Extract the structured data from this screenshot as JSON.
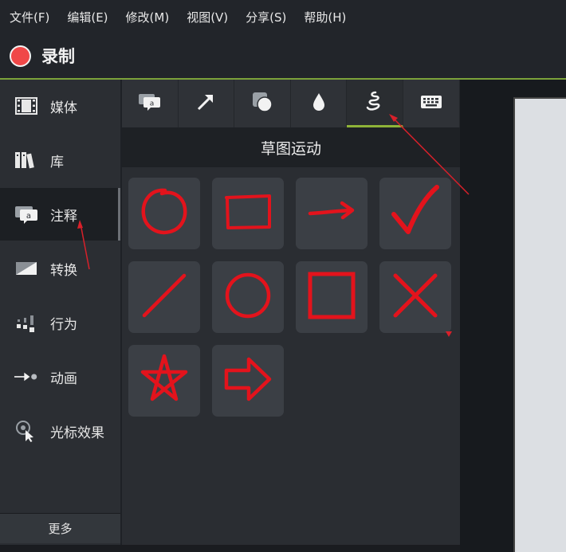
{
  "menubar": {
    "items": [
      {
        "label": "文件(F)"
      },
      {
        "label": "编辑(E)"
      },
      {
        "label": "修改(M)"
      },
      {
        "label": "视图(V)"
      },
      {
        "label": "分享(S)"
      },
      {
        "label": "帮助(H)"
      }
    ]
  },
  "recordbar": {
    "label": "录制",
    "dot_color": "#f04848"
  },
  "sidebar": {
    "items": [
      {
        "label": "媒体",
        "icon": "film-strip-icon"
      },
      {
        "label": "库",
        "icon": "books-icon"
      },
      {
        "label": "注释",
        "icon": "annotation-callout-icon",
        "active": true
      },
      {
        "label": "转换",
        "icon": "transition-icon"
      },
      {
        "label": "行为",
        "icon": "behavior-icon"
      },
      {
        "label": "动画",
        "icon": "animation-icon"
      },
      {
        "label": "光标效果",
        "icon": "cursor-effect-icon"
      }
    ],
    "more_label": "更多"
  },
  "panel": {
    "tabs": [
      {
        "icon": "callout-icon"
      },
      {
        "icon": "arrow-icon"
      },
      {
        "icon": "shapes-icon"
      },
      {
        "icon": "blur-drop-icon"
      },
      {
        "icon": "sketch-motion-icon",
        "active": true
      },
      {
        "icon": "keyboard-icon"
      }
    ],
    "title": "草图运动",
    "tiles": [
      {
        "icon": "sketch-circle-icon"
      },
      {
        "icon": "sketch-rectangle-icon"
      },
      {
        "icon": "sketch-arrow-icon"
      },
      {
        "icon": "sketch-checkmark-icon"
      },
      {
        "icon": "sketch-line-icon"
      },
      {
        "icon": "sketch-ellipse-icon"
      },
      {
        "icon": "sketch-square-icon"
      },
      {
        "icon": "sketch-x-icon"
      },
      {
        "icon": "sketch-star-icon"
      },
      {
        "icon": "sketch-block-arrow-icon"
      }
    ]
  },
  "colors": {
    "accent_green": "#8fb338",
    "sketch_red": "#e3131c",
    "annotation_red": "#d8202a"
  }
}
